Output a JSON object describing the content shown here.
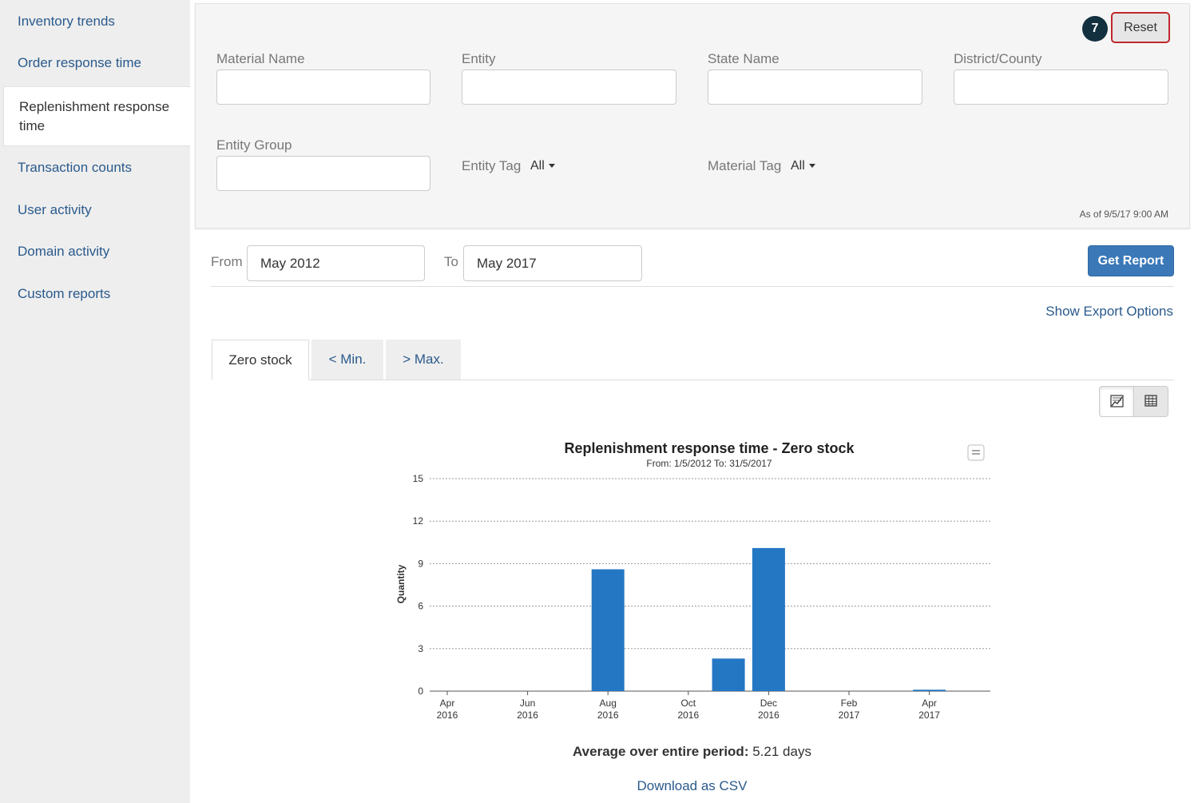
{
  "sidebar": {
    "items": [
      {
        "label": "Inventory trends"
      },
      {
        "label": "Order response time"
      },
      {
        "label": "Replenishment response time"
      },
      {
        "label": "Transaction counts"
      },
      {
        "label": "User activity"
      },
      {
        "label": "Domain activity"
      },
      {
        "label": "Custom reports"
      }
    ],
    "active_index": 2
  },
  "filters": {
    "material_name": {
      "label": "Material Name",
      "value": ""
    },
    "entity": {
      "label": "Entity",
      "value": ""
    },
    "state_name": {
      "label": "State Name",
      "value": ""
    },
    "district_county": {
      "label": "District/County",
      "value": ""
    },
    "entity_group": {
      "label": "Entity Group",
      "value": ""
    },
    "entity_tag": {
      "label": "Entity Tag",
      "value": "All"
    },
    "material_tag": {
      "label": "Material Tag",
      "value": "All"
    },
    "reset_label": "Reset",
    "step_badge": "7",
    "as_of": "As of 9/5/17 9:00 AM"
  },
  "date_range": {
    "from_label": "From",
    "from_value": "May 2012",
    "to_label": "To",
    "to_value": "May 2017",
    "get_report_label": "Get Report"
  },
  "export_link": "Show Export Options",
  "tabs": [
    {
      "label": "Zero stock",
      "active": true
    },
    {
      "label": "< Min.",
      "active": false
    },
    {
      "label": "> Max.",
      "active": false
    }
  ],
  "view_toggle": {
    "active": "chart",
    "icons": [
      "chart-icon",
      "table-icon"
    ]
  },
  "chart_data": {
    "type": "bar",
    "title": "Replenishment response time - Zero stock",
    "subtitle": "From: 1/5/2012 To: 31/5/2017",
    "ylabel": "Quantity",
    "xlabel": "",
    "ylim": [
      0,
      15
    ],
    "yticks": [
      0,
      3,
      6,
      9,
      12,
      15
    ],
    "grid": true,
    "legend": "none",
    "bar_color": "#2477c3",
    "x_tick_labels": [
      [
        "Apr",
        "2016"
      ],
      [
        "Jun",
        "2016"
      ],
      [
        "Aug",
        "2016"
      ],
      [
        "Oct",
        "2016"
      ],
      [
        "Dec",
        "2016"
      ],
      [
        "Feb",
        "2017"
      ],
      [
        "Apr",
        "2017"
      ]
    ],
    "categories": [
      "Apr 2016",
      "May 2016",
      "Jun 2016",
      "Jul 2016",
      "Aug 2016",
      "Sep 2016",
      "Oct 2016",
      "Nov 2016",
      "Dec 2016",
      "Jan 2017",
      "Feb 2017",
      "Mar 2017",
      "Apr 2017"
    ],
    "values": [
      0,
      0,
      0,
      0,
      8.6,
      0,
      0,
      2.3,
      10.1,
      0,
      0,
      0,
      0.1
    ]
  },
  "summary": {
    "average_label": "Average over entire period:",
    "average_value": "5.21 days"
  },
  "download_link": "Download as CSV",
  "colors": {
    "link": "#2a5a8c",
    "primary_button": "#3a78b8",
    "reset_border": "#c0282d",
    "badge": "#13303f"
  }
}
